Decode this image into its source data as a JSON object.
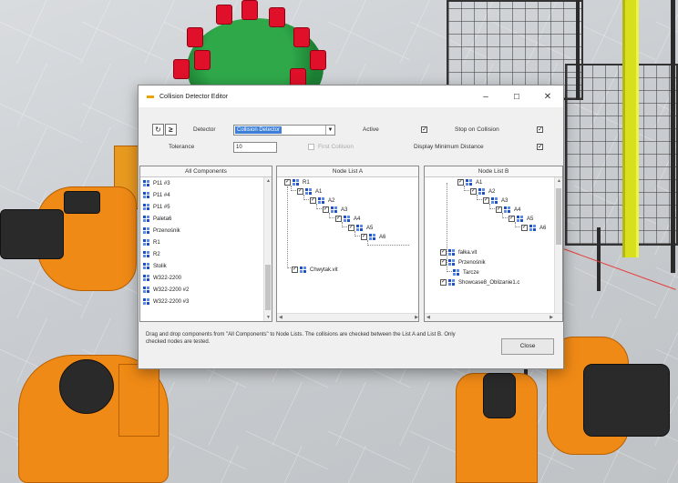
{
  "dialog": {
    "title": "Collision Detector Editor",
    "window_buttons": {
      "minimize": "–",
      "maximize": "☐",
      "close": "✕"
    },
    "toolbar": {
      "new_glyph": "↻",
      "next_glyph": "≥"
    },
    "detector_label": "Detector",
    "detector_value": "Collision Detector",
    "active_label": "Active",
    "active_checked": "✓",
    "stop_on_collision_label": "Stop on Collision",
    "stop_on_collision_checked": "✓",
    "tolerance_label": "Tolerance",
    "tolerance_value": "10",
    "first_collision_label": "First Collision",
    "display_min_distance_label": "Display Minimum Distance",
    "display_min_distance_checked": "✓",
    "panels": {
      "all_components": {
        "header": "All Components",
        "items": [
          "P11 #3",
          "P11 #4",
          "P11 #5",
          "Paleta6",
          "Przenośnik",
          "R1",
          "R2",
          "Stolik",
          "W322-2200",
          "W322-2200 #2",
          "W322-2200 #3"
        ]
      },
      "node_list_a": {
        "header": "Node List A",
        "nodes": [
          "R1",
          "A1",
          "A2",
          "A3",
          "A4",
          "A5",
          "A6"
        ],
        "extra": "Chwytak.vit"
      },
      "node_list_b": {
        "header": "Node List B",
        "nodes": [
          "A1",
          "A2",
          "A3",
          "A4",
          "A5",
          "A6"
        ],
        "extra": [
          "fałka.vit",
          "Przenośnik",
          "Tarcze",
          "Showcase8_Oblizanie1.c"
        ]
      }
    },
    "info_text": "Drag and drop components from \"All Components\" to Node Lists. The collisions are checked between the List A and List B. Only checked nodes are tested.",
    "close_label": "Close"
  },
  "colors": {
    "robot": "#f08a16",
    "yellow_post": "#d8df1c",
    "gear": "#2fa84a",
    "gear_bits": "#e0102a",
    "selection": "#3d7fd8"
  }
}
